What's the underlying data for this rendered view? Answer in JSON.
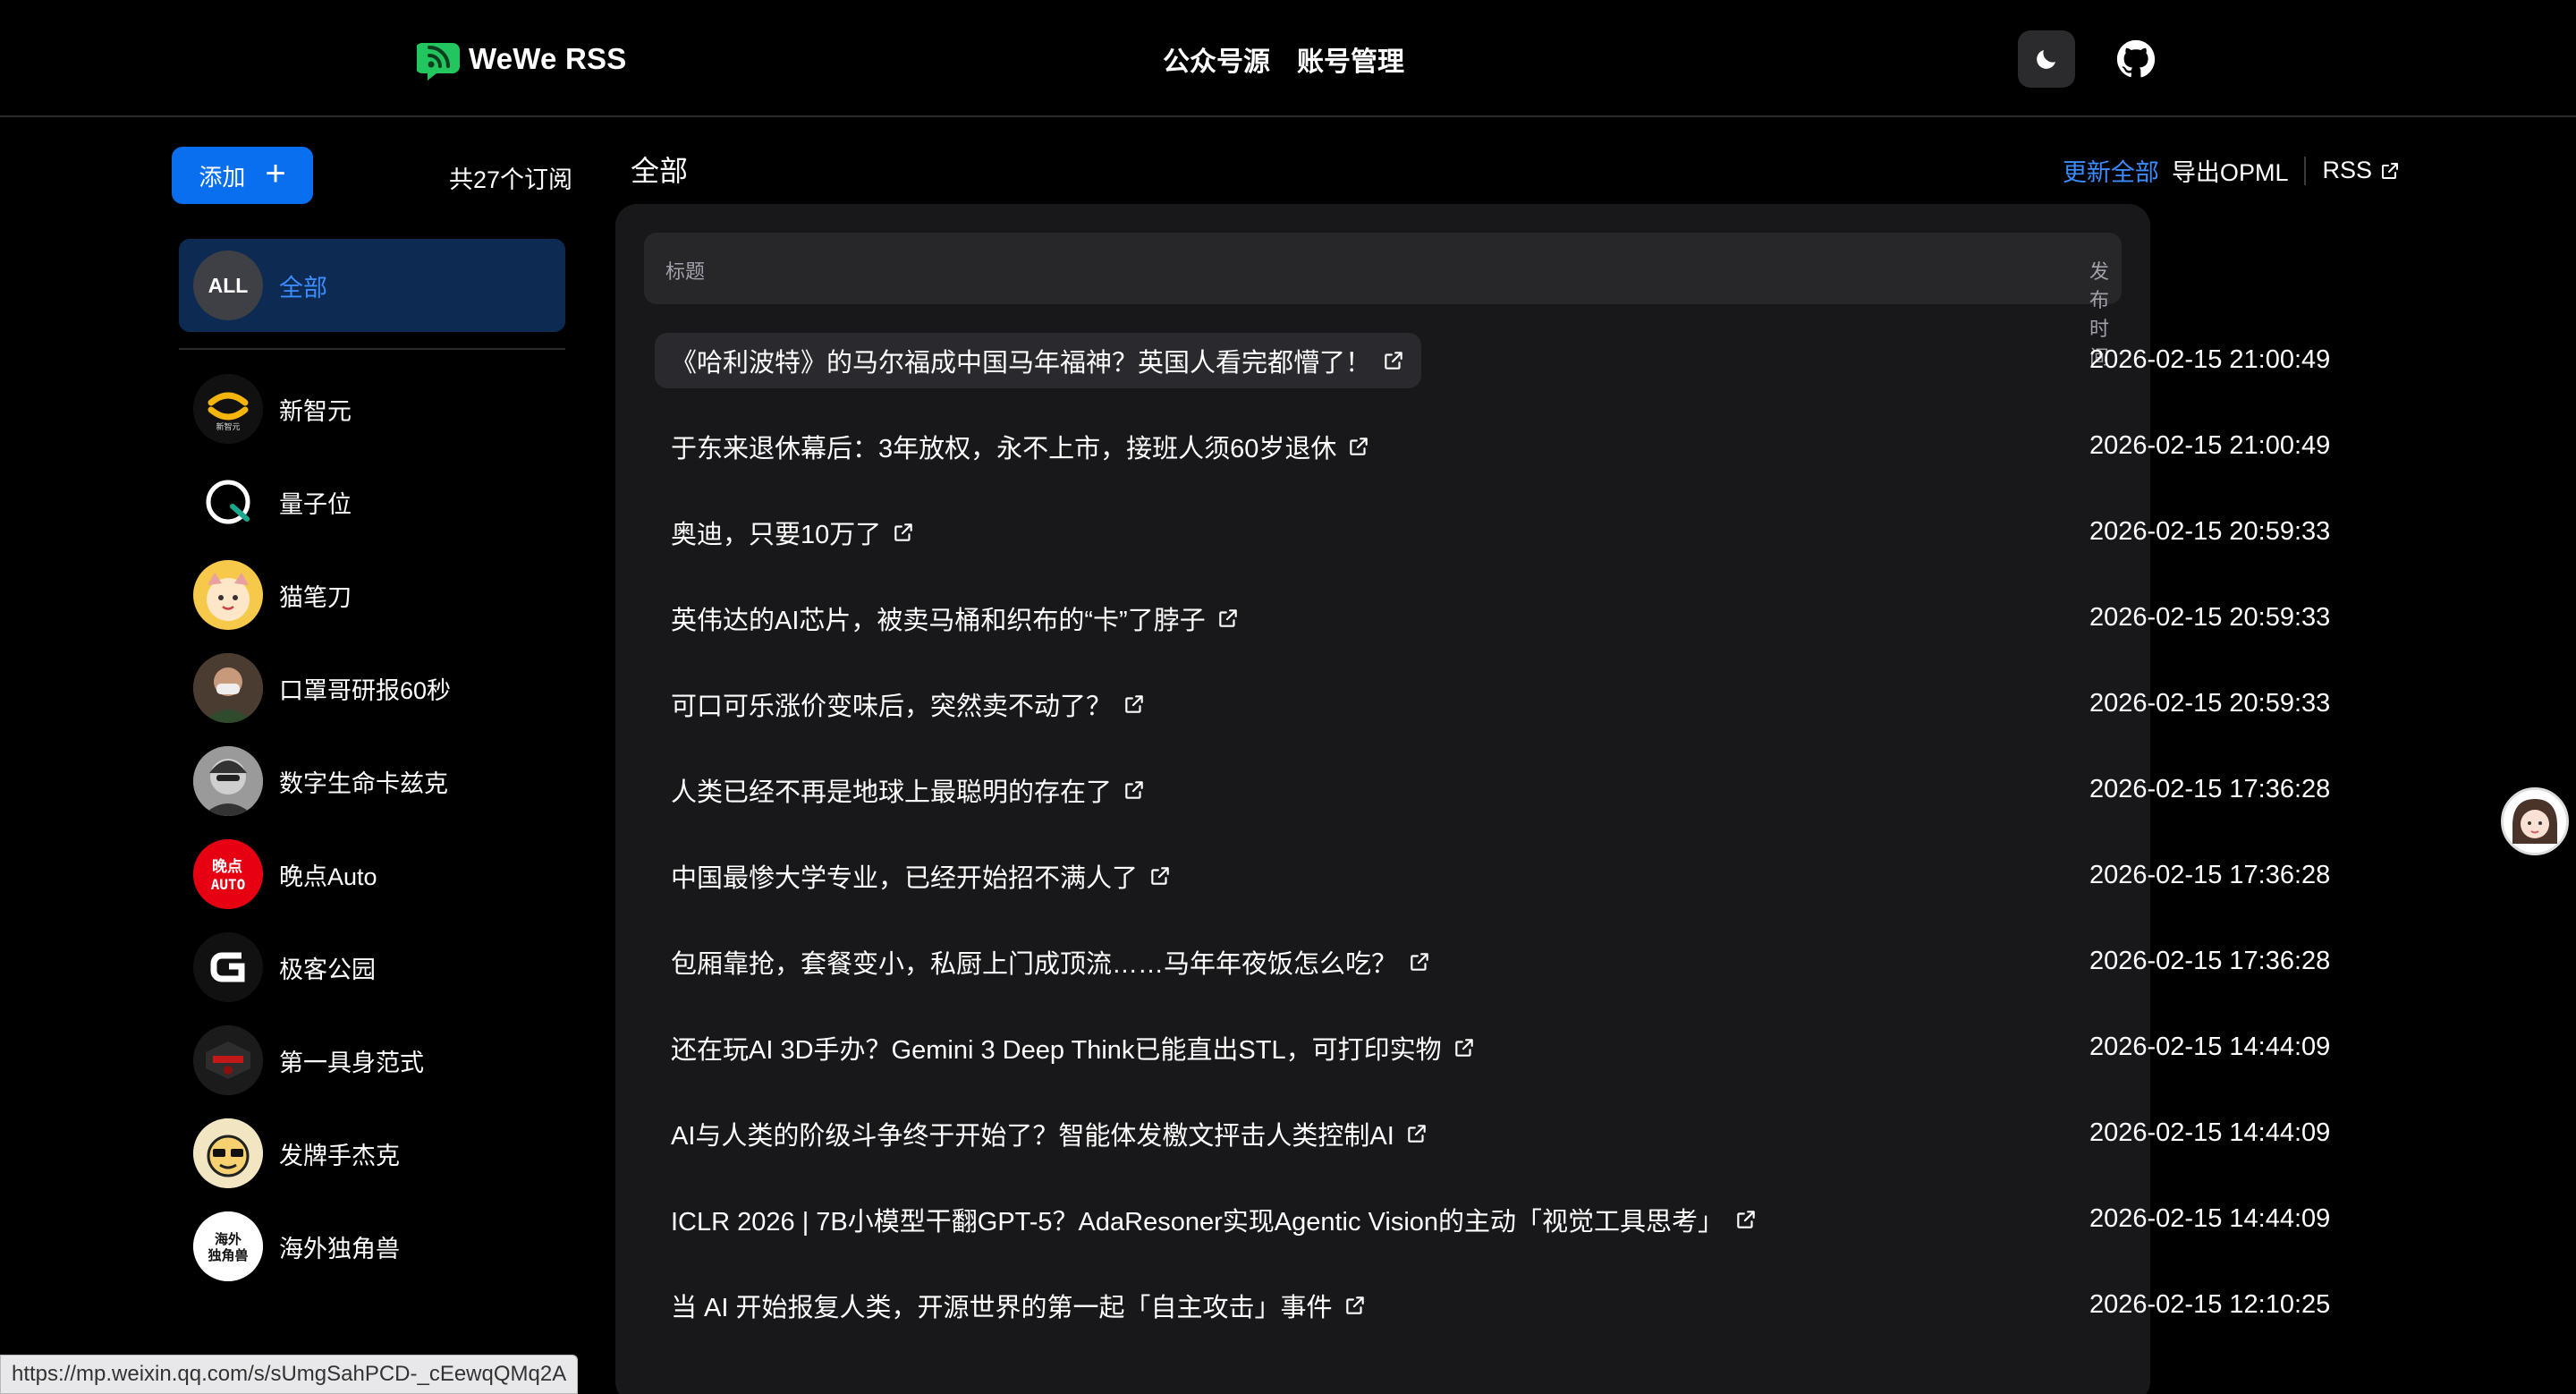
{
  "header": {
    "brand": "WeWe RSS",
    "nav": [
      "公众号源",
      "账号管理"
    ],
    "theme_icon": "moon-icon",
    "github_icon": "github-icon"
  },
  "sidebar": {
    "add_label": "添加",
    "subscription_count": "共27个订阅",
    "all": {
      "avatar_text": "ALL",
      "label": "全部"
    },
    "items": [
      {
        "label": "新智元",
        "avatar": "xinzhiyuan-logo"
      },
      {
        "label": "量子位",
        "avatar": "liangziwei-logo"
      },
      {
        "label": "猫笔刀",
        "avatar": "maobidao-avatar"
      },
      {
        "label": "口罩哥研报60秒",
        "avatar": "kouzhaoge-avatar"
      },
      {
        "label": "数字生命卡兹克",
        "avatar": "kazike-avatar"
      },
      {
        "label": "晚点Auto",
        "avatar": "wandian-auto-logo"
      },
      {
        "label": "极客公园",
        "avatar": "geekpark-logo"
      },
      {
        "label": "第一具身范式",
        "avatar": "diyijushen-avatar"
      },
      {
        "label": "发牌手杰克",
        "avatar": "fapaishou-avatar"
      },
      {
        "label": "海外独角兽",
        "avatar": "haiwai-dujiaoshou-logo"
      }
    ]
  },
  "main": {
    "title": "全部",
    "actions": {
      "update_all": "更新全部",
      "export_opml": "导出OPML",
      "rss": "RSS"
    },
    "columns": {
      "title": "标题",
      "published": "发布时间"
    },
    "rows": [
      {
        "title": "《哈利波特》的马尔福成中国马年福神？英国人看完都懵了！",
        "date": "2026-02-15 21:00:49"
      },
      {
        "title": "于东来退休幕后：3年放权，永不上市，接班人须60岁退休",
        "date": "2026-02-15 21:00:49"
      },
      {
        "title": "奥迪，只要10万了",
        "date": "2026-02-15 20:59:33"
      },
      {
        "title": "英伟达的AI芯片，被卖马桶和织布的“卡”了脖子",
        "date": "2026-02-15 20:59:33"
      },
      {
        "title": "可口可乐涨价变味后，突然卖不动了？",
        "date": "2026-02-15 20:59:33"
      },
      {
        "title": "人类已经不再是地球上最聪明的存在了",
        "date": "2026-02-15 17:36:28"
      },
      {
        "title": "中国最惨大学专业，已经开始招不满人了",
        "date": "2026-02-15 17:36:28"
      },
      {
        "title": "包厢靠抢，套餐变小，私厨上门成顶流……马年年夜饭怎么吃？",
        "date": "2026-02-15 17:36:28"
      },
      {
        "title": "还在玩AI 3D手办？Gemini 3 Deep Think已能直出STL，可打印实物",
        "date": "2026-02-15 14:44:09"
      },
      {
        "title": "AI与人类的阶级斗争终于开始了？智能体发檄文抨击人类控制AI",
        "date": "2026-02-15 14:44:09"
      },
      {
        "title": "ICLR 2026 | 7B小模型干翻GPT-5？AdaResoner实现Agentic Vision的主动「视觉工具思考」",
        "date": "2026-02-15 14:44:09"
      },
      {
        "title": "当 AI 开始报复人类，开源世界的第一起「自主攻击」事件",
        "date": "2026-02-15 12:10:25"
      }
    ]
  },
  "status_bar": {
    "url": "https://mp.weixin.qq.com/s/sUmgSahPCD-_cEewqQMq2A"
  }
}
